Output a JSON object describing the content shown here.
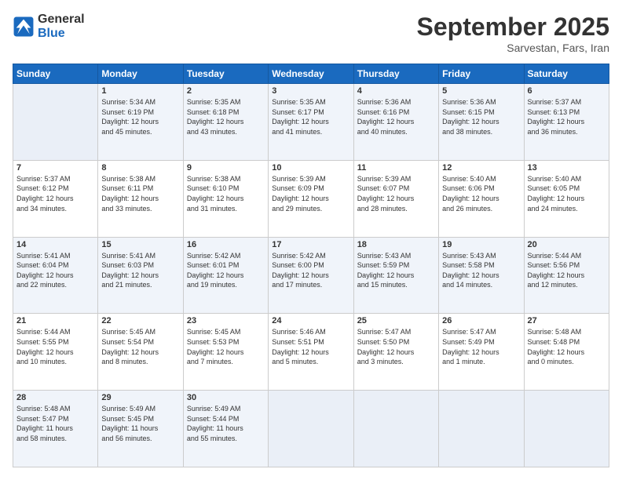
{
  "header": {
    "logo_line1": "General",
    "logo_line2": "Blue",
    "month": "September 2025",
    "location": "Sarvestan, Fars, Iran"
  },
  "days_of_week": [
    "Sunday",
    "Monday",
    "Tuesday",
    "Wednesday",
    "Thursday",
    "Friday",
    "Saturday"
  ],
  "weeks": [
    [
      {
        "day": "",
        "info": ""
      },
      {
        "day": "1",
        "info": "Sunrise: 5:34 AM\nSunset: 6:19 PM\nDaylight: 12 hours\nand 45 minutes."
      },
      {
        "day": "2",
        "info": "Sunrise: 5:35 AM\nSunset: 6:18 PM\nDaylight: 12 hours\nand 43 minutes."
      },
      {
        "day": "3",
        "info": "Sunrise: 5:35 AM\nSunset: 6:17 PM\nDaylight: 12 hours\nand 41 minutes."
      },
      {
        "day": "4",
        "info": "Sunrise: 5:36 AM\nSunset: 6:16 PM\nDaylight: 12 hours\nand 40 minutes."
      },
      {
        "day": "5",
        "info": "Sunrise: 5:36 AM\nSunset: 6:15 PM\nDaylight: 12 hours\nand 38 minutes."
      },
      {
        "day": "6",
        "info": "Sunrise: 5:37 AM\nSunset: 6:13 PM\nDaylight: 12 hours\nand 36 minutes."
      }
    ],
    [
      {
        "day": "7",
        "info": "Sunrise: 5:37 AM\nSunset: 6:12 PM\nDaylight: 12 hours\nand 34 minutes."
      },
      {
        "day": "8",
        "info": "Sunrise: 5:38 AM\nSunset: 6:11 PM\nDaylight: 12 hours\nand 33 minutes."
      },
      {
        "day": "9",
        "info": "Sunrise: 5:38 AM\nSunset: 6:10 PM\nDaylight: 12 hours\nand 31 minutes."
      },
      {
        "day": "10",
        "info": "Sunrise: 5:39 AM\nSunset: 6:09 PM\nDaylight: 12 hours\nand 29 minutes."
      },
      {
        "day": "11",
        "info": "Sunrise: 5:39 AM\nSunset: 6:07 PM\nDaylight: 12 hours\nand 28 minutes."
      },
      {
        "day": "12",
        "info": "Sunrise: 5:40 AM\nSunset: 6:06 PM\nDaylight: 12 hours\nand 26 minutes."
      },
      {
        "day": "13",
        "info": "Sunrise: 5:40 AM\nSunset: 6:05 PM\nDaylight: 12 hours\nand 24 minutes."
      }
    ],
    [
      {
        "day": "14",
        "info": "Sunrise: 5:41 AM\nSunset: 6:04 PM\nDaylight: 12 hours\nand 22 minutes."
      },
      {
        "day": "15",
        "info": "Sunrise: 5:41 AM\nSunset: 6:03 PM\nDaylight: 12 hours\nand 21 minutes."
      },
      {
        "day": "16",
        "info": "Sunrise: 5:42 AM\nSunset: 6:01 PM\nDaylight: 12 hours\nand 19 minutes."
      },
      {
        "day": "17",
        "info": "Sunrise: 5:42 AM\nSunset: 6:00 PM\nDaylight: 12 hours\nand 17 minutes."
      },
      {
        "day": "18",
        "info": "Sunrise: 5:43 AM\nSunset: 5:59 PM\nDaylight: 12 hours\nand 15 minutes."
      },
      {
        "day": "19",
        "info": "Sunrise: 5:43 AM\nSunset: 5:58 PM\nDaylight: 12 hours\nand 14 minutes."
      },
      {
        "day": "20",
        "info": "Sunrise: 5:44 AM\nSunset: 5:56 PM\nDaylight: 12 hours\nand 12 minutes."
      }
    ],
    [
      {
        "day": "21",
        "info": "Sunrise: 5:44 AM\nSunset: 5:55 PM\nDaylight: 12 hours\nand 10 minutes."
      },
      {
        "day": "22",
        "info": "Sunrise: 5:45 AM\nSunset: 5:54 PM\nDaylight: 12 hours\nand 8 minutes."
      },
      {
        "day": "23",
        "info": "Sunrise: 5:45 AM\nSunset: 5:53 PM\nDaylight: 12 hours\nand 7 minutes."
      },
      {
        "day": "24",
        "info": "Sunrise: 5:46 AM\nSunset: 5:51 PM\nDaylight: 12 hours\nand 5 minutes."
      },
      {
        "day": "25",
        "info": "Sunrise: 5:47 AM\nSunset: 5:50 PM\nDaylight: 12 hours\nand 3 minutes."
      },
      {
        "day": "26",
        "info": "Sunrise: 5:47 AM\nSunset: 5:49 PM\nDaylight: 12 hours\nand 1 minute."
      },
      {
        "day": "27",
        "info": "Sunrise: 5:48 AM\nSunset: 5:48 PM\nDaylight: 12 hours\nand 0 minutes."
      }
    ],
    [
      {
        "day": "28",
        "info": "Sunrise: 5:48 AM\nSunset: 5:47 PM\nDaylight: 11 hours\nand 58 minutes."
      },
      {
        "day": "29",
        "info": "Sunrise: 5:49 AM\nSunset: 5:45 PM\nDaylight: 11 hours\nand 56 minutes."
      },
      {
        "day": "30",
        "info": "Sunrise: 5:49 AM\nSunset: 5:44 PM\nDaylight: 11 hours\nand 55 minutes."
      },
      {
        "day": "",
        "info": ""
      },
      {
        "day": "",
        "info": ""
      },
      {
        "day": "",
        "info": ""
      },
      {
        "day": "",
        "info": ""
      }
    ]
  ]
}
